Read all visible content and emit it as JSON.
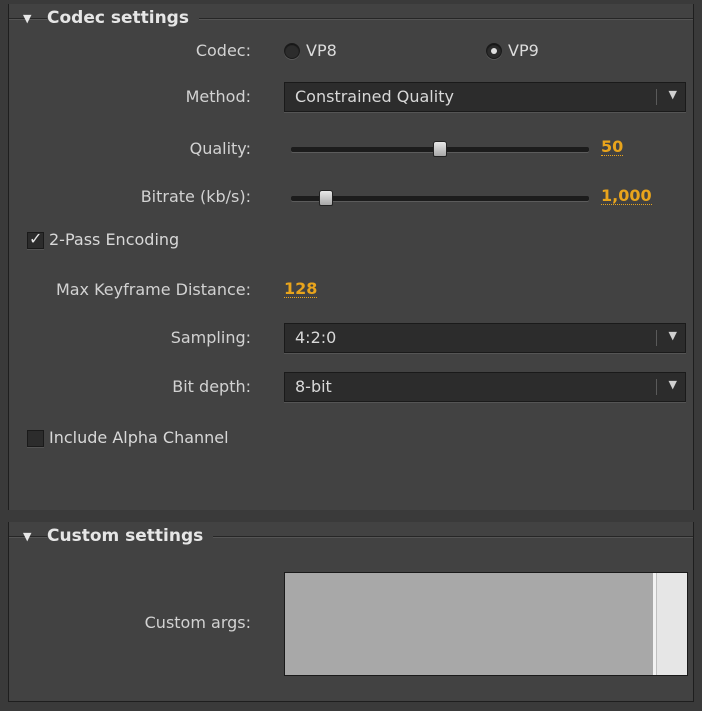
{
  "codec_section": {
    "title": "Codec settings",
    "codec": {
      "label": "Codec:",
      "options": [
        "VP8",
        "VP9"
      ],
      "selected": "VP9"
    },
    "method": {
      "label": "Method:",
      "value": "Constrained Quality"
    },
    "quality": {
      "label": "Quality:",
      "value": "50",
      "level": 0.5
    },
    "bitrate": {
      "label": "Bitrate (kb/s):",
      "value": "1,000",
      "level": 0.1
    },
    "two_pass": {
      "label": "2-Pass Encoding",
      "checked": true
    },
    "max_keyframe": {
      "label": "Max Keyframe Distance:",
      "value": "128"
    },
    "sampling": {
      "label": "Sampling:",
      "value": "4:2:0"
    },
    "bit_depth": {
      "label": "Bit depth:",
      "value": "8-bit"
    },
    "alpha": {
      "label": "Include Alpha Channel",
      "checked": false
    }
  },
  "custom_section": {
    "title": "Custom settings",
    "custom_args": {
      "label": "Custom args:",
      "value": ""
    }
  },
  "colors": {
    "accent": "#e8a41c",
    "panel_bg": "#424242",
    "control_bg": "#2c2c2c"
  },
  "icons": {
    "collapse": "triangle-down-icon",
    "dropdown": "chevron-down-icon",
    "check": "checkmark-icon"
  }
}
